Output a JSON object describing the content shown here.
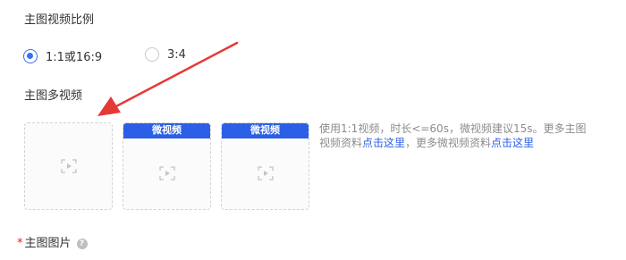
{
  "ratio": {
    "title": "主图视频比例",
    "options": [
      {
        "label": "1:1或16:9",
        "checked": true
      },
      {
        "label": "3:4",
        "checked": false
      }
    ]
  },
  "multi_video": {
    "title": "主图多视频",
    "boxes": [
      {
        "header": "",
        "icon": "video-placeholder-icon"
      },
      {
        "header": "微视频",
        "icon": "video-placeholder-icon"
      },
      {
        "header": "微视频",
        "icon": "video-placeholder-icon"
      }
    ],
    "hint": {
      "text_1": "使用1:1视频，时长<=60s，微视频建议15s。更多主图视频资料",
      "link_1": "点击这里",
      "text_2": "，更多微视频资料",
      "link_2": "点击这里"
    }
  },
  "main_image": {
    "required_mark": "*",
    "title": "主图图片",
    "help_icon": "?"
  },
  "colors": {
    "accent": "#2b5fe5",
    "arrow": "#e53935",
    "required": "#e02020"
  }
}
